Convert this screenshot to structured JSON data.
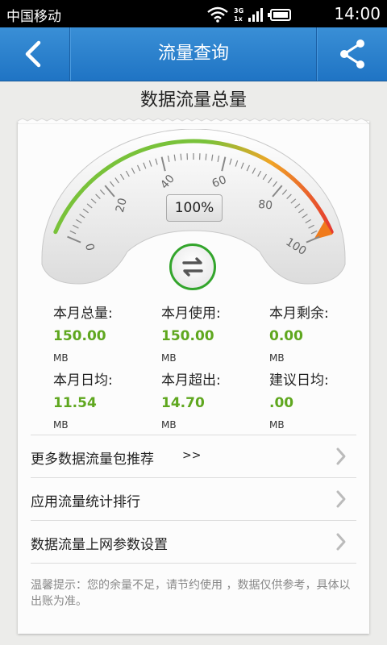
{
  "status_bar": {
    "carrier": "中国移动",
    "network": "3G",
    "network_sub": "1x",
    "time": "14:00"
  },
  "header": {
    "title": "流量查询",
    "back_icon": "back-icon",
    "share_icon": "share-icon"
  },
  "page": {
    "section_title": "数据流量总量"
  },
  "gauge": {
    "percent_text": "100%",
    "percent": 100,
    "tick_labels": [
      "0",
      "20",
      "40",
      "60",
      "80",
      "100"
    ],
    "colors": {
      "start": "#79c23a",
      "mid": "#f0a526",
      "end": "#e5392f"
    }
  },
  "stats": [
    {
      "label": "本月总量:",
      "value": "150.00",
      "unit": "MB"
    },
    {
      "label": "本月使用:",
      "value": "150.00",
      "unit": "MB"
    },
    {
      "label": "本月剩余:",
      "value": "0.00",
      "unit": "MB"
    },
    {
      "label": "本月日均:",
      "value": "11.54",
      "unit": "MB"
    },
    {
      "label": "本月超出:",
      "value": "14.70",
      "unit": "MB"
    },
    {
      "label": "建议日均:",
      "value": ".00",
      "unit": "MB"
    }
  ],
  "menu": [
    {
      "label": "更多数据流量包推荐",
      "extra": ">>"
    },
    {
      "label": "应用流量统计排行"
    },
    {
      "label": "数据流量上网参数设置"
    }
  ],
  "tip": "温馨提示：您的余量不足，请节约使用 ，数据仅供参考，具体以出账为准。",
  "accent": "#5fa71f"
}
